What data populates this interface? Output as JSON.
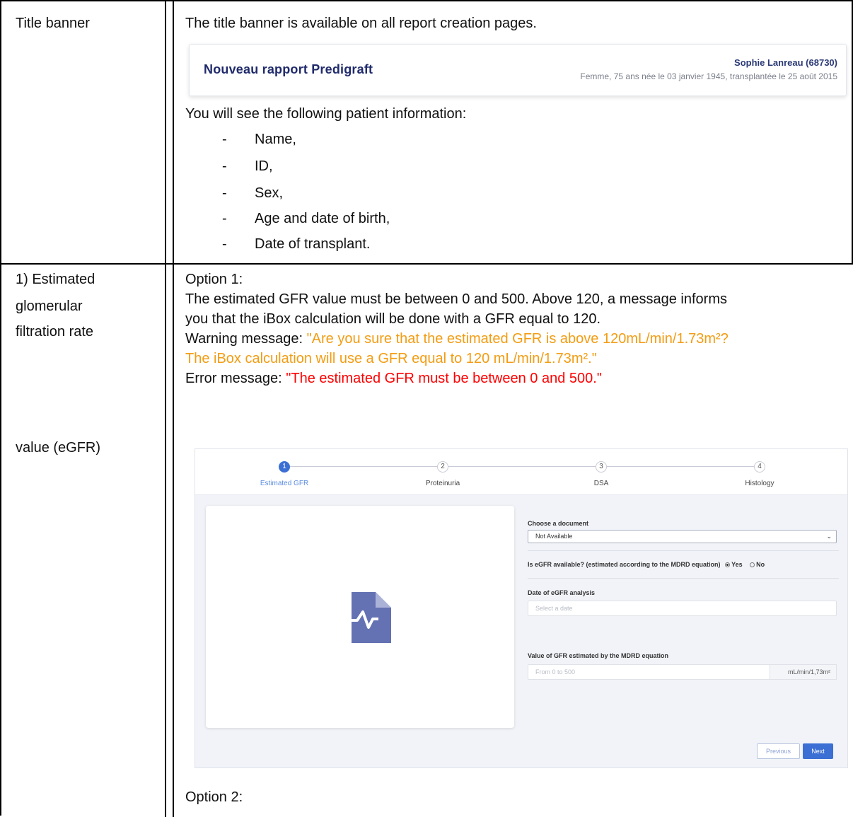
{
  "rows": [
    {
      "label": "Title banner",
      "intro": "The title banner is available on all report creation pages.",
      "banner": {
        "title": "Nouveau rapport Predigraft",
        "patient_name": "Sophie Lanreau (68730)",
        "patient_info": "Femme, 75 ans née le 03 janvier 1945, transplantée le 25 août 2015"
      },
      "info_intro": "You will see the following patient information:",
      "list_marker": "-",
      "list": [
        "Name,",
        "ID,",
        "Sex,",
        "Age and date of birth,",
        "Date of transplant."
      ]
    },
    {
      "label_lines": [
        "1) Estimated",
        "glomerular",
        "filtration rate"
      ],
      "label_tail": "value (eGFR)",
      "option1_title": "Option 1:",
      "option1_desc_1": "The estimated GFR value must be between 0 and 500. Above 120, a message informs",
      "option1_desc_2": "you that the iBox calculation will be done with a GFR equal to 120.",
      "warning_label": "Warning message: ",
      "warning_text_1": "\"Are you sure that the estimated GFR is above 120mL/min/1.73m²?",
      "warning_text_2": "The iBox calculation will use a GFR equal to 120 mL/min/1.73m².\"",
      "error_label": "Error message: ",
      "error_text": "\"The estimated GFR must be between 0 and 500.\"",
      "option2_title": "Option 2:"
    }
  ],
  "wizard": {
    "steps": [
      {
        "number": "1",
        "label": "Estimated GFR"
      },
      {
        "number": "2",
        "label": "Proteinuria"
      },
      {
        "number": "3",
        "label": "DSA"
      },
      {
        "number": "4",
        "label": "Histology"
      }
    ],
    "choose_document_label": "Choose a document",
    "choose_document_value": "Not Available",
    "egfr_question": "Is eGFR available? (estimated according to the MDRD equation)",
    "radio_yes": "Yes",
    "radio_no": "No",
    "date_label": "Date of eGFR analysis",
    "date_placeholder": "Select a date",
    "value_label": "Value of GFR estimated by the MDRD equation",
    "value_placeholder": "From 0 to 500",
    "unit": "mL/min/1,73m²",
    "previous_button": "Previous",
    "next_button": "Next",
    "colors": {
      "accent": "#3b6fd4",
      "warning": "#f39c12",
      "error": "#ff0000"
    }
  }
}
